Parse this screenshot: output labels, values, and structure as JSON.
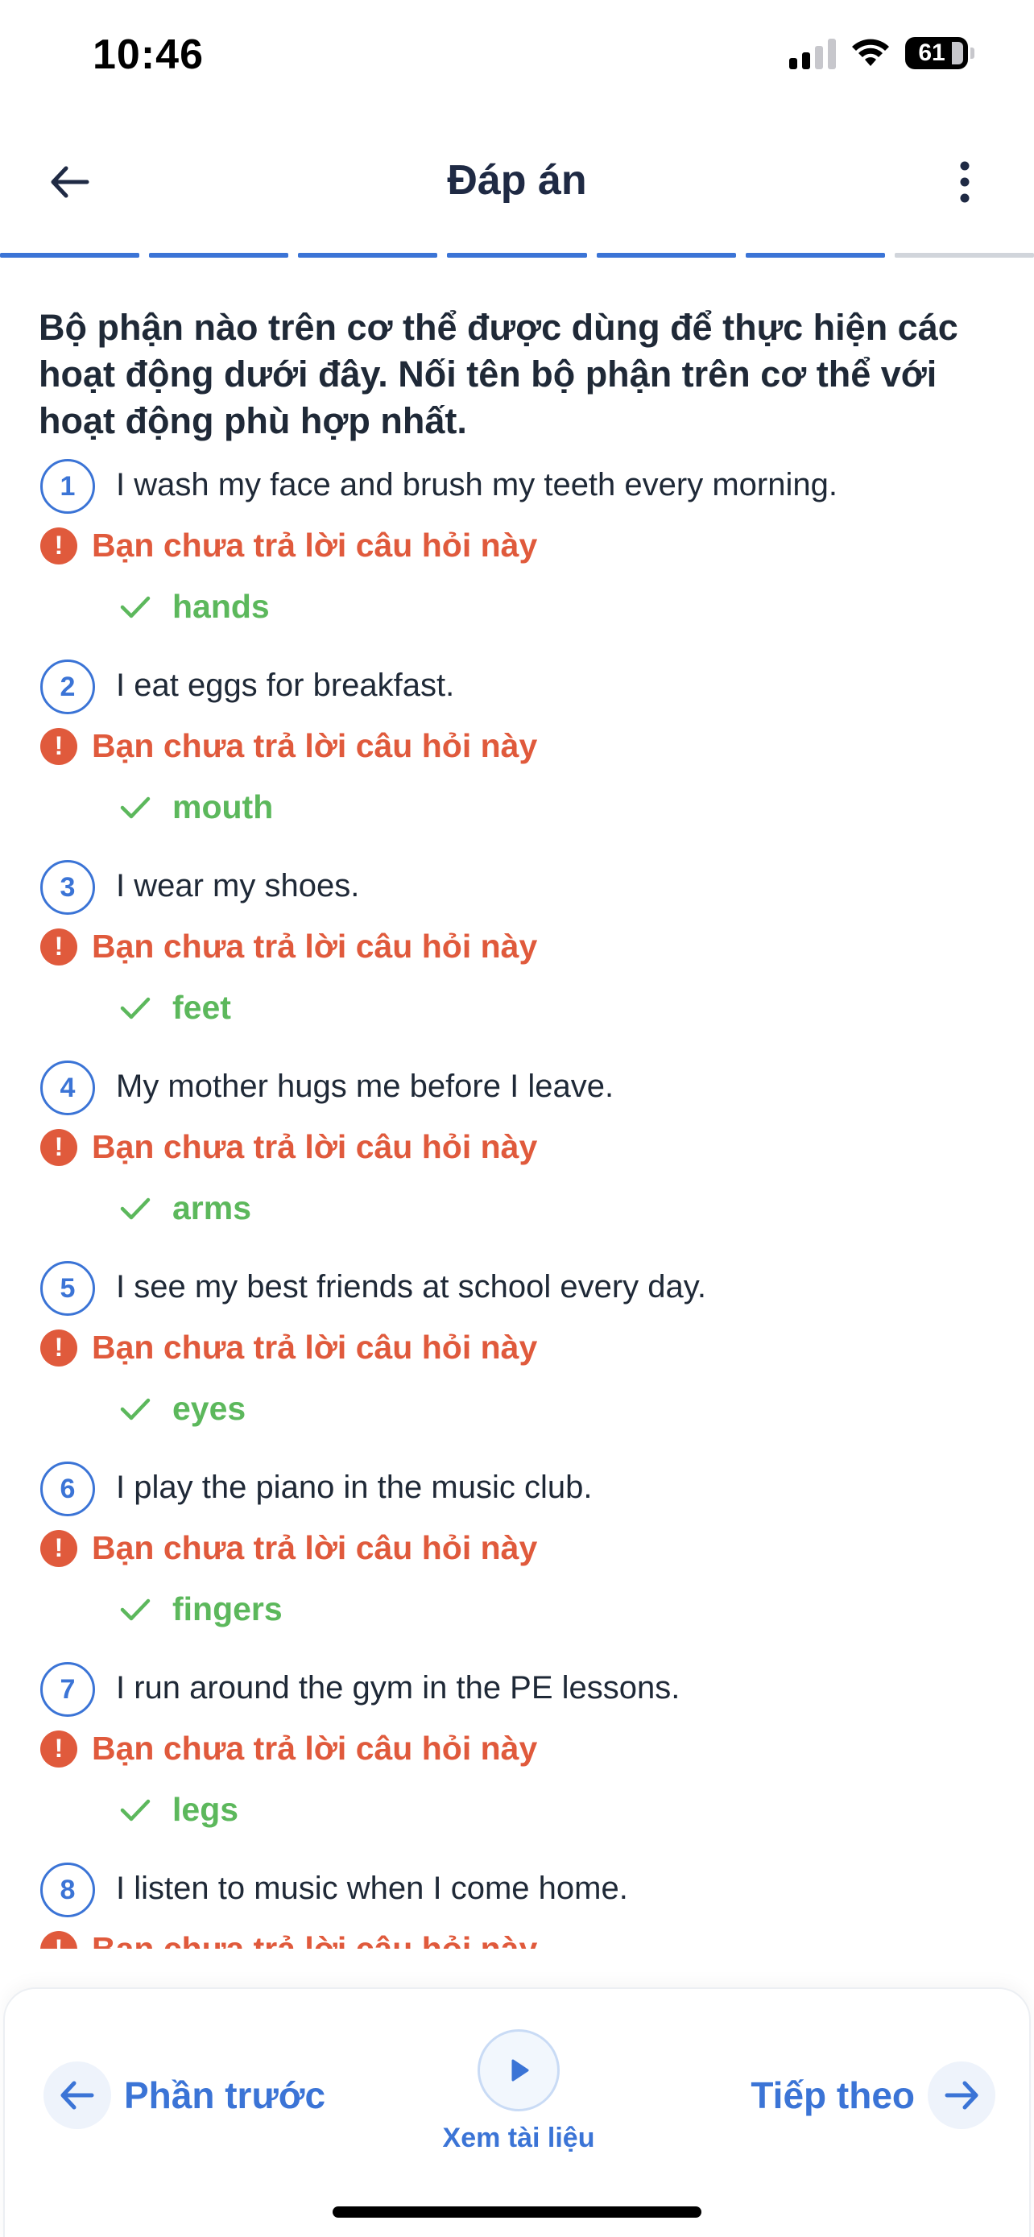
{
  "status_bar": {
    "time": "10:46",
    "battery": "61"
  },
  "header": {
    "title": "Đáp án"
  },
  "progress": {
    "total_segments": 7,
    "completed_segments": 6
  },
  "question": "Bộ phận nào trên cơ thể được dùng để thực hiện các hoạt động dưới đây. Nối tên bộ phận trên cơ thể với hoạt động phù hợp nhất.",
  "items": [
    {
      "number": "1",
      "sentence": "I wash my face and brush my teeth every morning.",
      "warning": "Bạn chưa trả lời câu hỏi này",
      "answer": "hands"
    },
    {
      "number": "2",
      "sentence": "I eat eggs for breakfast.",
      "warning": "Bạn chưa trả lời câu hỏi này",
      "answer": "mouth"
    },
    {
      "number": "3",
      "sentence": "I wear my shoes.",
      "warning": "Bạn chưa trả lời câu hỏi này",
      "answer": "feet"
    },
    {
      "number": "4",
      "sentence": "My mother hugs me before I leave.",
      "warning": "Bạn chưa trả lời câu hỏi này",
      "answer": "arms"
    },
    {
      "number": "5",
      "sentence": "I see my best friends at school every day.",
      "warning": "Bạn chưa trả lời câu hỏi này",
      "answer": "eyes"
    },
    {
      "number": "6",
      "sentence": "I play the piano in the music club.",
      "warning": "Bạn chưa trả lời câu hỏi này",
      "answer": "fingers"
    },
    {
      "number": "7",
      "sentence": "I run around the gym in the PE lessons.",
      "warning": "Bạn chưa trả lời câu hỏi này",
      "answer": "legs"
    },
    {
      "number": "8",
      "sentence": "I listen to music when I come home.",
      "warning": "Bạn chưa trả lời câu hỏi này",
      "answer": ""
    }
  ],
  "bottom_bar": {
    "prev_label": "Phần trước",
    "doc_label": "Xem tài liệu",
    "next_label": "Tiếp theo"
  },
  "colors": {
    "accent": "#3b74d6",
    "warning": "#e05a3c",
    "correct": "#5cb85c"
  }
}
